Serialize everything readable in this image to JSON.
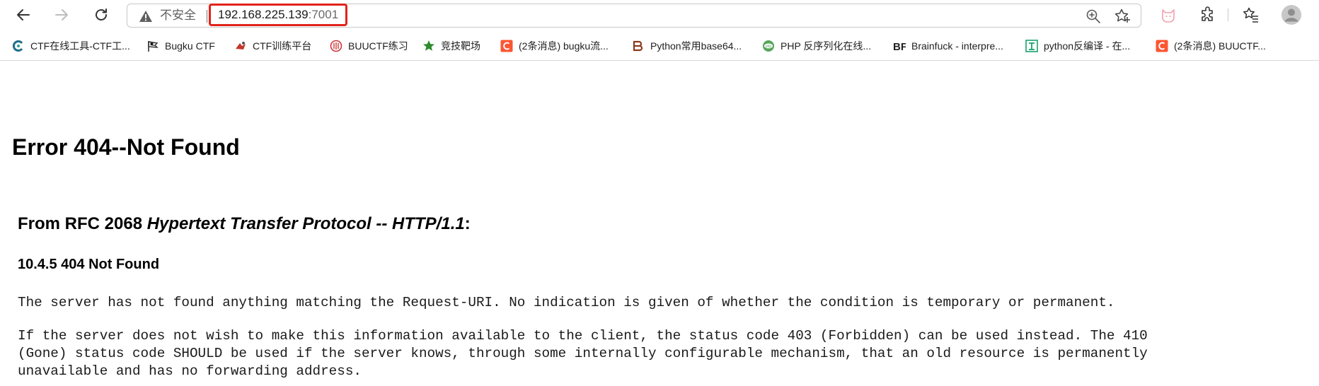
{
  "browser": {
    "security_label": "不安全",
    "url_host": "192.168.225.139",
    "url_port": ":7001"
  },
  "bookmarks": [
    {
      "label": "CTF在线工具-CTF工...",
      "icon": "ctf-tools-icon",
      "color": "#1f6e8c"
    },
    {
      "label": "Bugku CTF",
      "icon": "flag-icon",
      "color": "#333333"
    },
    {
      "label": "CTF训练平台",
      "icon": "ctf-platform-icon",
      "color": "#c0392b"
    },
    {
      "label": "BUUCTF练习",
      "icon": "buuctf-icon",
      "color": "#d0363b"
    },
    {
      "label": "竞技靶场",
      "icon": "star-icon",
      "color": "#2e8b2e"
    },
    {
      "label": "(2条消息) bugku流...",
      "icon": "csdn-icon",
      "color": "#fc5531"
    },
    {
      "label": "Python常用base64...",
      "icon": "b-logo-icon",
      "color": "#8b3a1a"
    },
    {
      "label": "PHP 反序列化在线...",
      "icon": "php-icon",
      "color": "#58a55c"
    },
    {
      "label": "Brainfuck - interpre...",
      "icon": "bf-icon",
      "color": "#222222"
    },
    {
      "label": "python反编译 - 在...",
      "icon": "decompile-icon",
      "color": "#1aa06d"
    },
    {
      "label": "(2条消息) BUUCTF...",
      "icon": "csdn-icon",
      "color": "#fc5531"
    }
  ],
  "page": {
    "title": "Error 404--Not Found",
    "rfc_prefix": "From RFC 2068 ",
    "rfc_title": "Hypertext Transfer Protocol -- HTTP/1.1",
    "rfc_suffix": ":",
    "section": "10.4.5 404 Not Found",
    "para1": "The server has not found anything matching the Request-URI. No indication is given of whether the condition is temporary or permanent.",
    "para2": "If the server does not wish to make this information available to the client, the status code 403 (Forbidden) can be used instead. The 410\n(Gone) status code SHOULD be used if the server knows, through some internally configurable mechanism, that an old resource is permanently\nunavailable and has no forwarding address."
  }
}
